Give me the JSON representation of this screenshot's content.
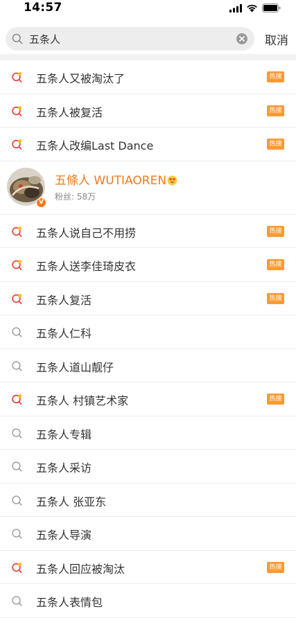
{
  "status_bar": {
    "time": "14:57"
  },
  "search": {
    "query": "五条人",
    "cancel_label": "取消"
  },
  "user_card": {
    "name": "五條人 WUTIAOREN",
    "fans": "粉丝: 58万",
    "verified_mark": "V"
  },
  "suggestions_top": [
    {
      "label": "五条人又被淘汰了",
      "trending": true,
      "badge": "热搜"
    },
    {
      "label": "五条人被复活",
      "trending": true,
      "badge": "热搜"
    },
    {
      "label": "五条人改编Last Dance",
      "trending": true,
      "badge": "热搜"
    }
  ],
  "suggestions": [
    {
      "label": "五条人说自己不用捞",
      "trending": true,
      "badge": "热搜"
    },
    {
      "label": "五条人送李佳琦皮衣",
      "trending": true,
      "badge": "热搜"
    },
    {
      "label": "五条人复活",
      "trending": true,
      "badge": "热搜"
    },
    {
      "label": "五条人仁科",
      "trending": false,
      "badge": ""
    },
    {
      "label": "五条人道山靓仔",
      "trending": false,
      "badge": ""
    },
    {
      "label": "五条人 村镇艺术家",
      "trending": true,
      "badge": "热搜"
    },
    {
      "label": "五条人专辑",
      "trending": false,
      "badge": ""
    },
    {
      "label": "五条人采访",
      "trending": false,
      "badge": ""
    },
    {
      "label": "五条人 张亚东",
      "trending": false,
      "badge": ""
    },
    {
      "label": "五条人导演",
      "trending": false,
      "badge": ""
    },
    {
      "label": "五条人回应被淘汰",
      "trending": true,
      "badge": "热搜"
    },
    {
      "label": "五条人表情包",
      "trending": false,
      "badge": ""
    }
  ],
  "colors": {
    "accent": "#f27a1a",
    "badge": "#ff9a30",
    "trend_red": "#e8423f",
    "trend_yellow": "#f7c21a"
  }
}
